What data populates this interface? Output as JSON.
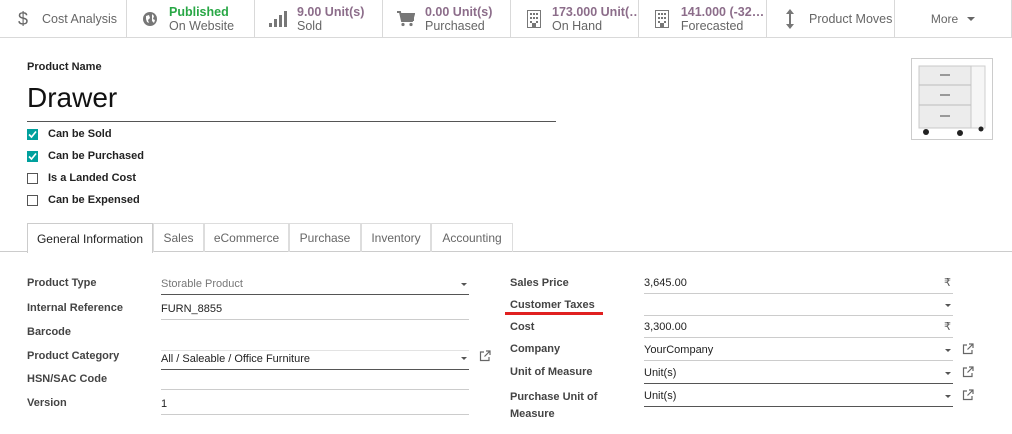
{
  "smart_buttons": {
    "cost_analysis": "Cost Analysis",
    "published": {
      "value": "Published",
      "label": "On Website"
    },
    "sold": {
      "value": "9.00 Unit(s)",
      "label": "Sold"
    },
    "purchased": {
      "value": "0.00 Unit(s)",
      "label": "Purchased"
    },
    "on_hand": {
      "value": "173.000 Unit(…",
      "label": "On Hand"
    },
    "forecasted": {
      "value": "141.000 (-32…",
      "label": "Forecasted"
    },
    "product_moves": "Product Moves",
    "more": "More"
  },
  "product": {
    "name_label": "Product Name",
    "name": "Drawer",
    "image_icon": "drawer-cabinet-image"
  },
  "checkboxes": [
    {
      "label": "Can be Sold",
      "checked": true
    },
    {
      "label": "Can be Purchased",
      "checked": true
    },
    {
      "label": "Is a Landed Cost",
      "checked": false
    },
    {
      "label": "Can be Expensed",
      "checked": false
    }
  ],
  "tabs": [
    "General Information",
    "Sales",
    "eCommerce",
    "Purchase",
    "Inventory",
    "Accounting"
  ],
  "left_fields": {
    "product_type": {
      "label": "Product Type",
      "value": "Storable Product"
    },
    "internal_reference": {
      "label": "Internal Reference",
      "value": "FURN_8855"
    },
    "barcode": {
      "label": "Barcode",
      "value": ""
    },
    "product_category": {
      "label": "Product Category",
      "value": "All / Saleable / Office Furniture"
    },
    "hsn_sac": {
      "label": "HSN/SAC Code",
      "value": ""
    },
    "version": {
      "label": "Version",
      "value": "1"
    }
  },
  "right_fields": {
    "sales_price": {
      "label": "Sales Price",
      "value": "3,645.00",
      "currency": "₹"
    },
    "customer_taxes": {
      "label": "Customer Taxes",
      "value": ""
    },
    "cost": {
      "label": "Cost",
      "value": "3,300.00",
      "currency": "₹"
    },
    "company": {
      "label": "Company",
      "value": "YourCompany"
    },
    "uom": {
      "label": "Unit of Measure",
      "value": "Unit(s)"
    },
    "purchase_uom": {
      "label_line1": "Purchase Unit of",
      "label_line2": "Measure",
      "value": "Unit(s)"
    }
  },
  "colors": {
    "accent": "#00a09d",
    "value_purple": "#8c6d8a",
    "published_green": "#28a745",
    "highlight_red": "#e02020"
  }
}
